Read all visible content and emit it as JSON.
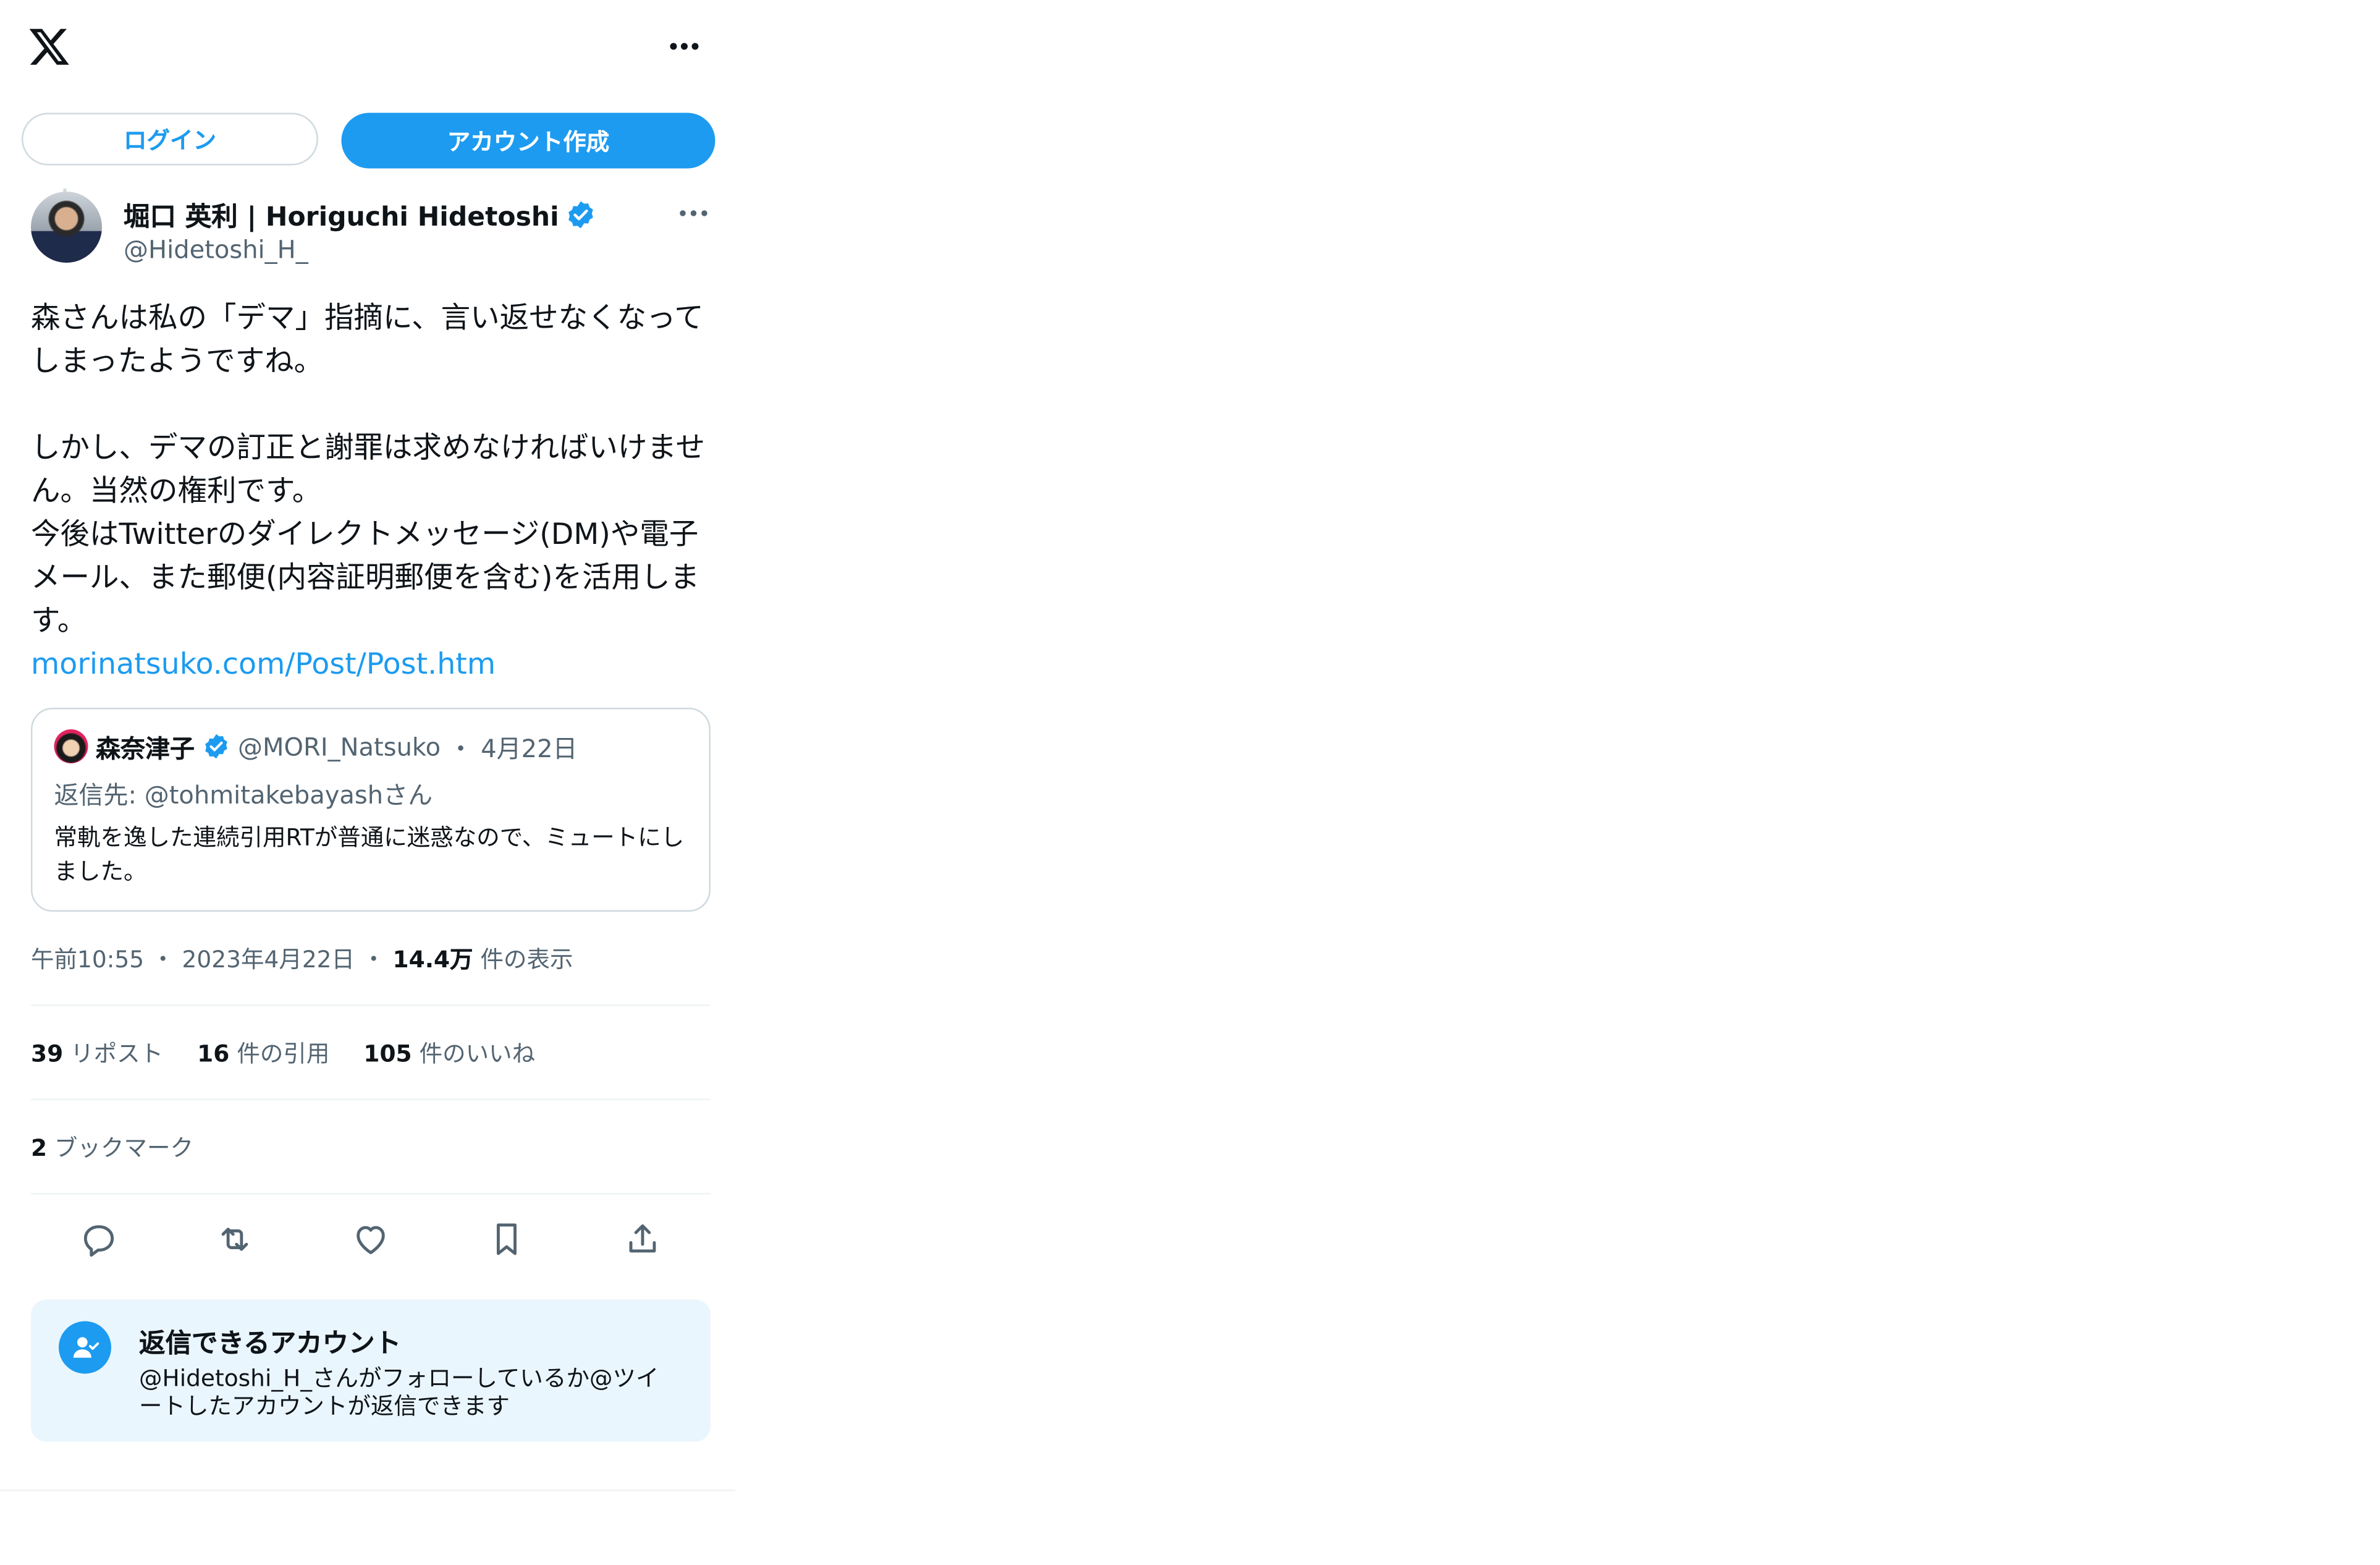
{
  "header": {
    "logo_icon": "x-logo-icon",
    "more_icon": "more-horizontal-icon"
  },
  "auth": {
    "login_label": "ログイン",
    "signup_label": "アカウント作成"
  },
  "tweet": {
    "author": {
      "display_name": "堀口 英利 | Horiguchi Hidetoshi",
      "handle": "@Hidetoshi_H_",
      "verified": true
    },
    "body": {
      "para1": "森さんは私の「デマ」指摘に、言い返せなくなってしまったようですね。",
      "para2": "しかし、デマの訂正と謝罪は求めなければいけません。当然の権利です。",
      "para3": "今後はTwitterのダイレクトメッセージ(DM)や電子メール、また郵便(内容証明郵便を含む)を活用します。",
      "link": "morinatsuko.com/Post/Post.htm"
    },
    "quote": {
      "name": "森奈津子",
      "handle": "@MORI_Natsuko",
      "separator": "・",
      "date": "4月22日",
      "reply_to": "返信先: @tohmitakebayashさん",
      "text": "常軌を逸した連続引用RTが普通に迷惑なので、ミュートにしました。"
    },
    "meta": {
      "time": "午前10:55",
      "sep1": "・",
      "date": "2023年4月22日",
      "sep2": "・",
      "views_count": "14.4万",
      "views_label": "件の表示"
    },
    "stats": {
      "reposts_count": "39",
      "reposts_label": "リポスト",
      "quotes_count": "16",
      "quotes_label": "件の引用",
      "likes_count": "105",
      "likes_label": "件のいいね",
      "bookmarks_count": "2",
      "bookmarks_label": "ブックマーク"
    },
    "actions": [
      "reply-icon",
      "repost-icon",
      "like-icon",
      "bookmark-icon",
      "share-icon"
    ]
  },
  "reply_restriction": {
    "title": "返信できるアカウント",
    "description": "@Hidetoshi_H_さんがフォローしているか@ツイートしたアカウントが返信できます"
  },
  "colors": {
    "accent": "#1d9bf0",
    "text": "#0f1419",
    "secondary": "#536471",
    "border": "#cfd9de",
    "reply_card_bg": "#eaf6fd"
  }
}
